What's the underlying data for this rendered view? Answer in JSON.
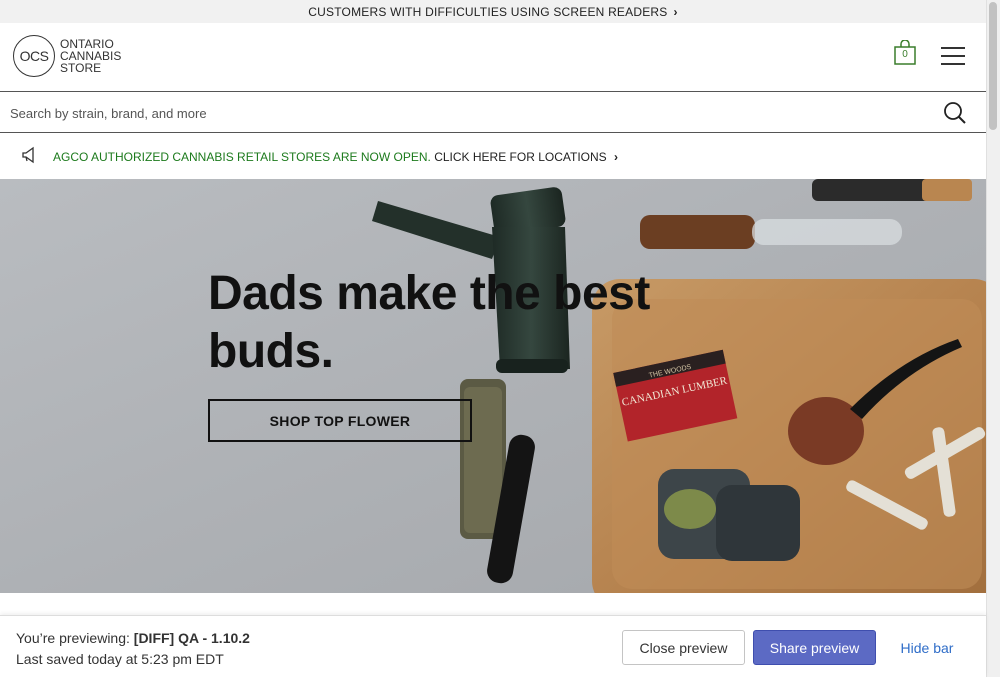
{
  "topbar": {
    "text": "CUSTOMERS WITH DIFFICULTIES USING SCREEN READERS",
    "chevron": "›"
  },
  "header": {
    "logo": {
      "mark": "OCS",
      "line1": "ONTARIO",
      "line2": "CANNABIS",
      "line3": "STORE"
    },
    "cart": {
      "count": "0",
      "icon": "shopping-bag-icon"
    },
    "menu_icon": "hamburger-menu-icon"
  },
  "search": {
    "placeholder": "Search by strain, brand, and more",
    "value": "",
    "icon": "search-icon"
  },
  "notice": {
    "icon": "megaphone-icon",
    "green_text": "AGCO AUTHORIZED CANNABIS RETAIL STORES ARE NOW OPEN.",
    "link_text": "CLICK HERE FOR LOCATIONS",
    "chevron": "›"
  },
  "hero": {
    "headline_line1": "Dads make the best",
    "headline_line2": "buds.",
    "cta_label": "SHOP TOP FLOWER",
    "box_label_top": "THE WOODS",
    "box_label": "CANADIAN LUMBER"
  },
  "preview_bar": {
    "previewing_prefix": "You’re previewing:",
    "theme_name": "[DIFF] QA - 1.10.2",
    "saved_text": "Last saved today at 5:23 pm EDT",
    "close_label": "Close preview",
    "share_label": "Share preview",
    "hide_label": "Hide bar"
  },
  "colors": {
    "accent_green": "#1c7a1c",
    "share_button": "#5c6ac4",
    "link_blue": "#2f6dc8",
    "topbar_bg": "#f1f1f1"
  }
}
